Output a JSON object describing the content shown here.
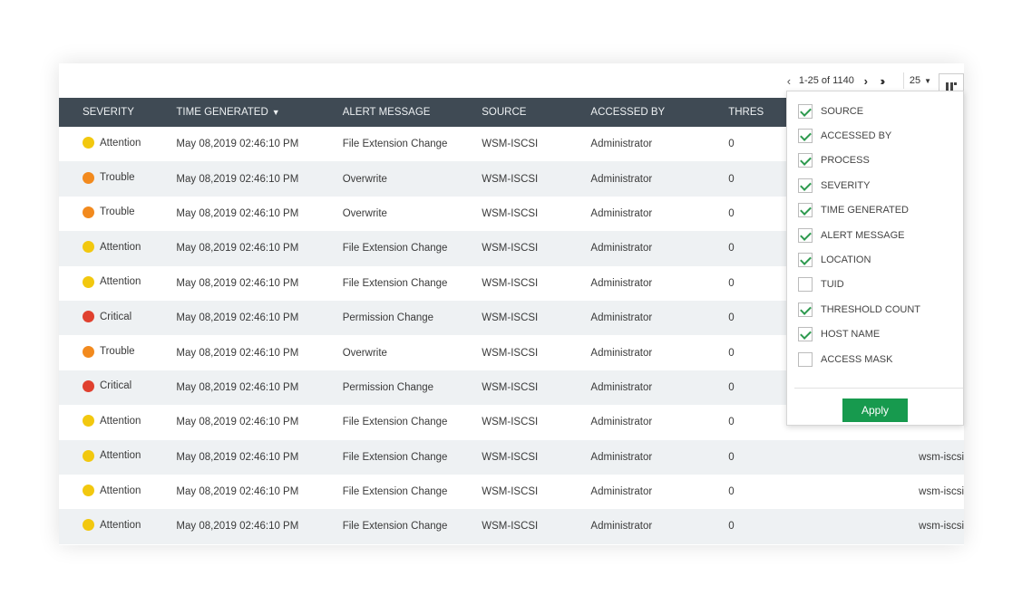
{
  "pager": {
    "prev_icon": "chevron-left-icon",
    "range": "1-25 of 1140",
    "next_icon": "chevron-right-icon",
    "last_icon": "double-chevron-right-icon",
    "page_size": "25"
  },
  "columns": {
    "severity": "SEVERITY",
    "time_generated": "TIME GENERATED",
    "alert_message": "ALERT MESSAGE",
    "source": "SOURCE",
    "accessed_by": "ACCESSED BY",
    "threshold": "THRES"
  },
  "severity_colors": {
    "Attention": "#f2c80f",
    "Trouble": "#f28a1e",
    "Critical": "#e0412f"
  },
  "rows": [
    {
      "severity": "Attention",
      "time": "May 08,2019 02:46:10 PM",
      "message": "File Extension Change",
      "source": "WSM-ISCSI",
      "accessed_by": "Administrator",
      "threshold": "0",
      "host": ""
    },
    {
      "severity": "Trouble",
      "time": "May 08,2019 02:46:10 PM",
      "message": "Overwrite",
      "source": "WSM-ISCSI",
      "accessed_by": "Administrator",
      "threshold": "0",
      "host": ""
    },
    {
      "severity": "Trouble",
      "time": "May 08,2019 02:46:10 PM",
      "message": "Overwrite",
      "source": "WSM-ISCSI",
      "accessed_by": "Administrator",
      "threshold": "0",
      "host": ""
    },
    {
      "severity": "Attention",
      "time": "May 08,2019 02:46:10 PM",
      "message": "File Extension Change",
      "source": "WSM-ISCSI",
      "accessed_by": "Administrator",
      "threshold": "0",
      "host": ""
    },
    {
      "severity": "Attention",
      "time": "May 08,2019 02:46:10 PM",
      "message": "File Extension Change",
      "source": "WSM-ISCSI",
      "accessed_by": "Administrator",
      "threshold": "0",
      "host": ""
    },
    {
      "severity": "Critical",
      "time": "May 08,2019 02:46:10 PM",
      "message": "Permission Change",
      "source": "WSM-ISCSI",
      "accessed_by": "Administrator",
      "threshold": "0",
      "host": ""
    },
    {
      "severity": "Trouble",
      "time": "May 08,2019 02:46:10 PM",
      "message": "Overwrite",
      "source": "WSM-ISCSI",
      "accessed_by": "Administrator",
      "threshold": "0",
      "host": ""
    },
    {
      "severity": "Critical",
      "time": "May 08,2019 02:46:10 PM",
      "message": "Permission Change",
      "source": "WSM-ISCSI",
      "accessed_by": "Administrator",
      "threshold": "0",
      "host": ""
    },
    {
      "severity": "Attention",
      "time": "May 08,2019 02:46:10 PM",
      "message": "File Extension Change",
      "source": "WSM-ISCSI",
      "accessed_by": "Administrator",
      "threshold": "0",
      "host": ""
    },
    {
      "severity": "Attention",
      "time": "May 08,2019 02:46:10 PM",
      "message": "File Extension Change",
      "source": "WSM-ISCSI",
      "accessed_by": "Administrator",
      "threshold": "0",
      "host": "wsm-iscsi"
    },
    {
      "severity": "Attention",
      "time": "May 08,2019 02:46:10 PM",
      "message": "File Extension Change",
      "source": "WSM-ISCSI",
      "accessed_by": "Administrator",
      "threshold": "0",
      "host": "wsm-iscsi"
    },
    {
      "severity": "Attention",
      "time": "May 08,2019 02:46:10 PM",
      "message": "File Extension Change",
      "source": "WSM-ISCSI",
      "accessed_by": "Administrator",
      "threshold": "0",
      "host": "wsm-iscsi"
    }
  ],
  "column_chooser": {
    "items": [
      {
        "label": "SOURCE",
        "checked": true
      },
      {
        "label": "ACCESSED BY",
        "checked": true
      },
      {
        "label": "PROCESS",
        "checked": true
      },
      {
        "label": "SEVERITY",
        "checked": true
      },
      {
        "label": "TIME GENERATED",
        "checked": true
      },
      {
        "label": "ALERT MESSAGE",
        "checked": true
      },
      {
        "label": "LOCATION",
        "checked": true
      },
      {
        "label": "TUID",
        "checked": false
      },
      {
        "label": "THRESHOLD COUNT",
        "checked": true
      },
      {
        "label": "HOST NAME",
        "checked": true
      },
      {
        "label": "ACCESS MASK",
        "checked": false
      }
    ],
    "apply_label": "Apply",
    "apply_color": "#179a4e"
  },
  "accent": {
    "header_bg": "#3f4a54",
    "row_alt_bg": "#eef1f3"
  }
}
